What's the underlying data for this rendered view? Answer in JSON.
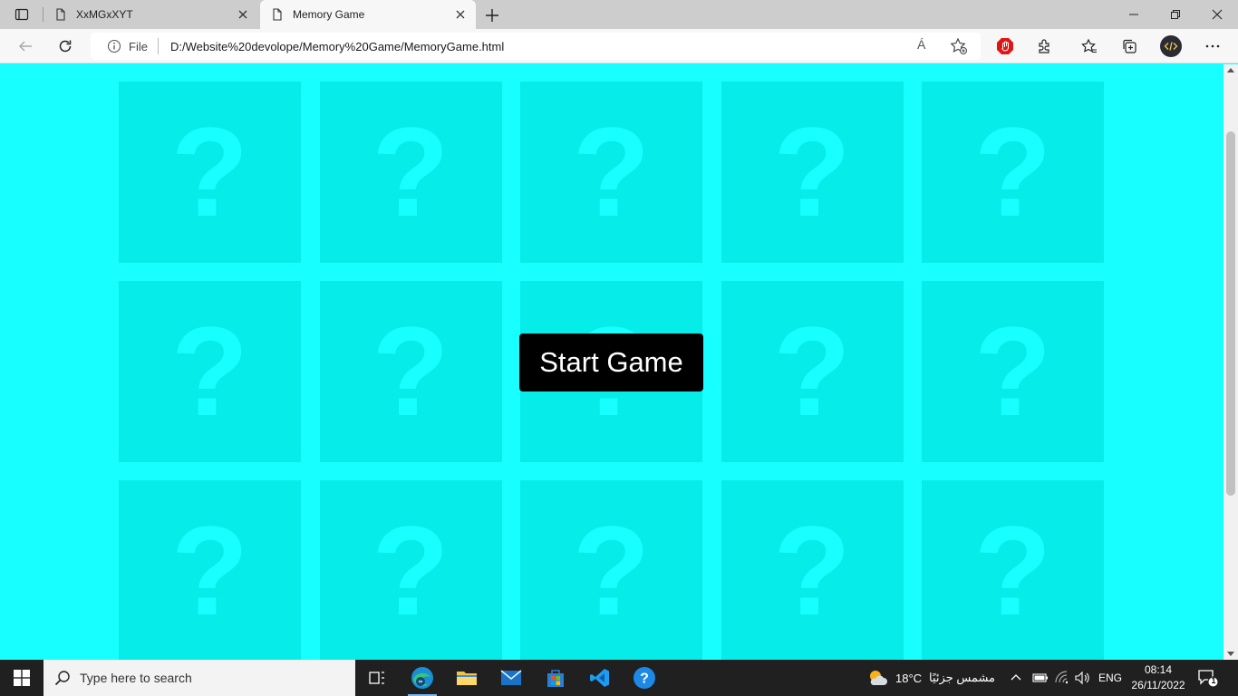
{
  "browser": {
    "tabs": [
      {
        "title": "XxMGxXYT",
        "active": false
      },
      {
        "title": "Memory Game",
        "active": true
      }
    ],
    "address": {
      "scheme_label": "File",
      "url": "D:/Website%20devolope/Memory%20Game/MemoryGame.html"
    },
    "read_aloud_label": "Á"
  },
  "game": {
    "card_symbol": "?",
    "cards": [
      "?",
      "?",
      "?",
      "?",
      "?",
      "?",
      "?",
      "?",
      "?",
      "?",
      "?",
      "?",
      "?",
      "?",
      "?"
    ],
    "start_button_label": "Start Game",
    "colors": {
      "background": "#18ffff",
      "card": "#05ece9",
      "button": "#000000",
      "button_text": "#ffffff"
    }
  },
  "taskbar": {
    "search_placeholder": "Type here to search",
    "weather": {
      "temp": "18°C",
      "condition": "مشمس جزئيًا"
    },
    "language": "ENG",
    "time": "08:14",
    "date": "26/11/2022",
    "notification_count": "1"
  }
}
